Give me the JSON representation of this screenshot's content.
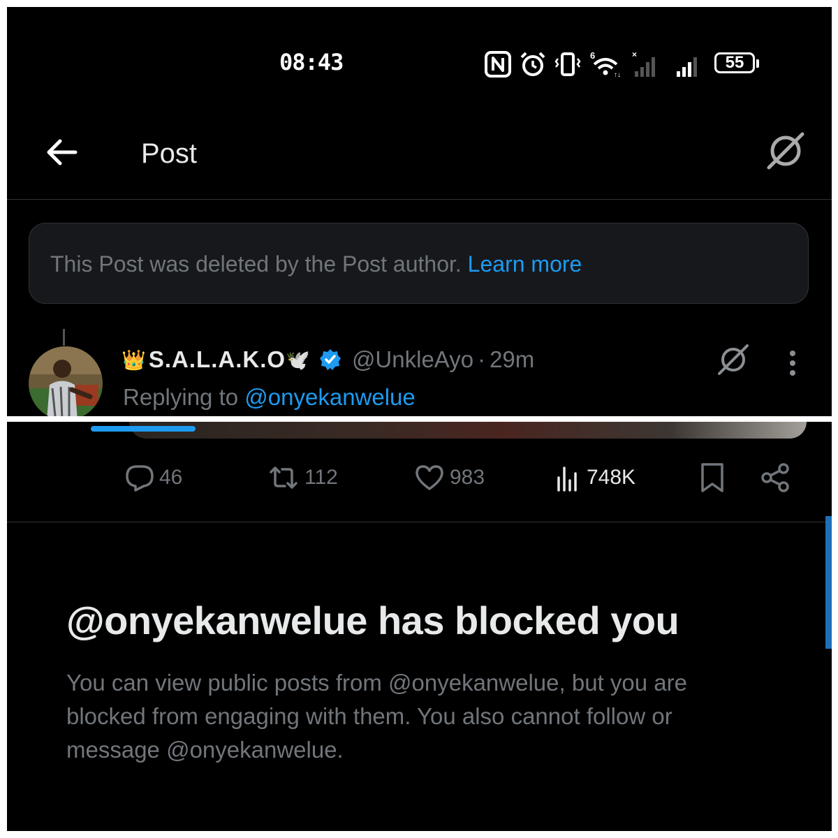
{
  "status_bar": {
    "time": "08:43",
    "battery": "55",
    "icons": [
      "nfc-icon",
      "alarm-icon",
      "vibrate-icon",
      "wifi-icon",
      "signal-icon",
      "signal-icon"
    ]
  },
  "header": {
    "title": "Post"
  },
  "deleted_notice": {
    "text": "This Post was deleted by the Post author.",
    "link": "Learn more"
  },
  "tweet": {
    "name_emoji_prefix": "👑",
    "author_name": "S.A.L.A.K.O",
    "name_emoji_suffix": "🕊️",
    "handle": "@UnkleAyo",
    "separator": "·",
    "time": "29m",
    "replying_prefix": "Replying to",
    "replying_to": "@onyekanwelue"
  },
  "actions": {
    "replies": "46",
    "reposts": "112",
    "likes": "983",
    "views": "748K"
  },
  "blocked": {
    "title": "@onyekanwelue has blocked you",
    "body": "You can view public posts from @onyekanwelue, but you are blocked from engaging with them. You also cannot follow or message @onyekanwelue."
  },
  "colors": {
    "background": "#000000",
    "accent": "#1d9bf0",
    "text_primary": "#e7e9ea",
    "text_secondary": "#71767b",
    "divider": "#2f3336"
  }
}
